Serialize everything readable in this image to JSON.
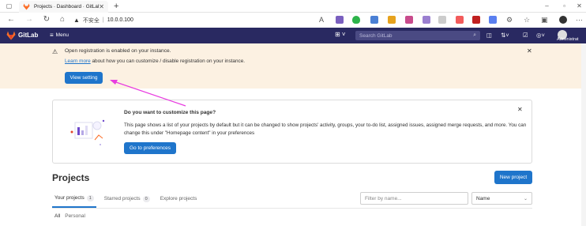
{
  "browser": {
    "tab_title": "Projects · Dashboard · GitLab",
    "new_tab": "+",
    "security_warning": "不安全",
    "url": "10.0.0.100"
  },
  "header": {
    "brand": "GitLab",
    "menu_label": "Menu",
    "search_placeholder": "Search GitLab",
    "user_label": "Administrat"
  },
  "banner": {
    "title": "Open registration is enabled on your instance.",
    "link_text": "Learn more",
    "text_rest": " about how you can customize / disable registration on your instance.",
    "button": "View setting"
  },
  "customize_card": {
    "title": "Do you want to customize this page?",
    "text": "This page shows a list of your projects by default but it can be changed to show projects' activity, groups, your to-do list, assigned issues, assigned merge requests, and more. You can change this under \"Homepage content\" in your preferences",
    "button": "Go to preferences"
  },
  "projects": {
    "title": "Projects",
    "new_project": "New project",
    "tabs": [
      {
        "label": "Your projects",
        "count": "1"
      },
      {
        "label": "Starred projects",
        "count": "0"
      },
      {
        "label": "Explore projects",
        "count": ""
      }
    ],
    "filter_placeholder": "Filter by name...",
    "sort_value": "Name",
    "subtabs": [
      "All",
      "Personal"
    ]
  },
  "colors": {
    "header_bg": "#292961",
    "banner_bg": "#fcf1e2",
    "primary": "#1f75cb",
    "annotation_arrow": "#e83ce0"
  }
}
